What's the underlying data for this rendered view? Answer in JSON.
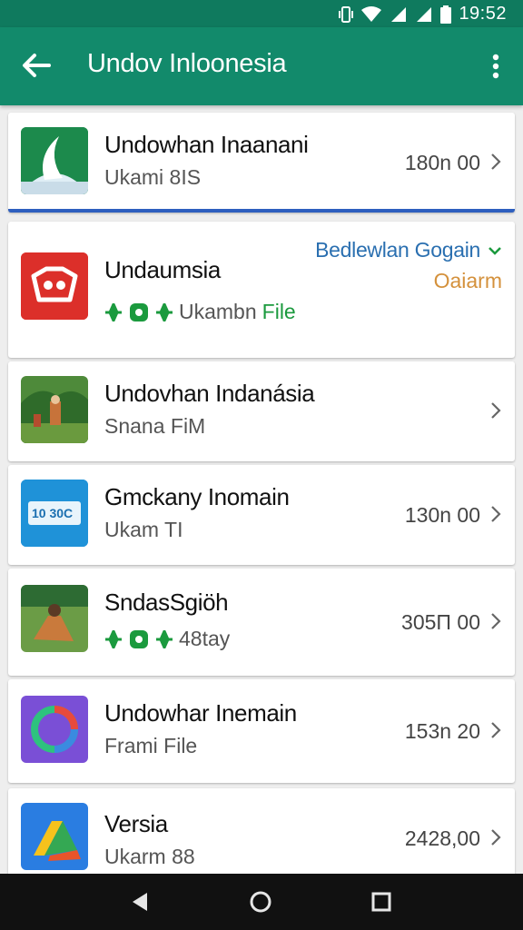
{
  "status_bar": {
    "time": "19:52"
  },
  "app_bar": {
    "title": "Undov Inloonesia"
  },
  "items": [
    {
      "name": "Undowhan Inaanani",
      "subtitle": "Ukami 8IS",
      "size": "180n 00"
    },
    {
      "name": "Undaumsia",
      "subtitle": "Ukambn",
      "subtitle_accent": "File",
      "status": "Bedlewlan Gogain",
      "status2": "Oaiarm"
    },
    {
      "name": "Undovhan Indanásia",
      "subtitle": "Snana FiM"
    },
    {
      "name": "Gmckany Inomain",
      "subtitle": "Ukam TI",
      "size": "130n 00",
      "icon_text": "10 30C"
    },
    {
      "name": "SndasSgiöh",
      "subtitle": "48tay",
      "size": "305Π 00"
    },
    {
      "name": "Undowhar Inemain",
      "subtitle": "Frami File",
      "size": "153n 20"
    },
    {
      "name": "Versia",
      "subtitle": "Ukarm 88",
      "size": "2428,00"
    }
  ],
  "colors": {
    "primary": "#128a6b",
    "status_dark": "#0f7a5e",
    "link_blue": "#2a6fb0",
    "accent_orange": "#d4913c",
    "tag_green": "#1b9a3e"
  },
  "icons": [
    "back-arrow-icon",
    "more-vert-icon",
    "chevron-right-icon",
    "chevron-down-icon",
    "wifi-icon",
    "signal-icon",
    "battery-icon",
    "nav-back-icon",
    "nav-home-icon",
    "nav-recents-icon"
  ]
}
